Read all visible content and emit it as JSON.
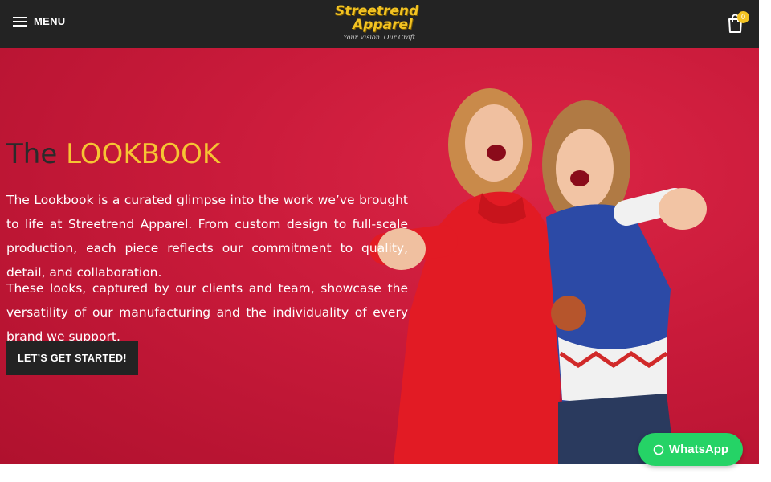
{
  "header": {
    "menu_label": "MENU",
    "logo": {
      "line1": "Streetrend",
      "line2": "Apparel",
      "tagline": "Your Vision. Our Craft"
    },
    "cart_count": "0"
  },
  "hero": {
    "title_prefix": "The",
    "title_accent": "LOOKBOOK",
    "paragraph1": "The Lookbook is a curated glimpse into the work we’ve brought to life at Streetrend Apparel. From custom design to full-scale production, each piece reflects our commitment to quality, detail, and collaboration.",
    "paragraph2": "These looks, captured by our clients and team, showcase the versatility of our manufacturing and the individuality of every brand we support.",
    "cta_label": "LET’S GET STARTED!"
  },
  "whatsapp": {
    "label": "WhatsApp"
  },
  "colors": {
    "header_bg": "#232323",
    "accent": "#f3c322",
    "hero_bg": "#c81a3a",
    "whatsapp": "#25d366"
  },
  "icons": {
    "menu": "hamburger-icon",
    "cart": "shopping-bag-icon",
    "whatsapp": "whatsapp-icon"
  }
}
